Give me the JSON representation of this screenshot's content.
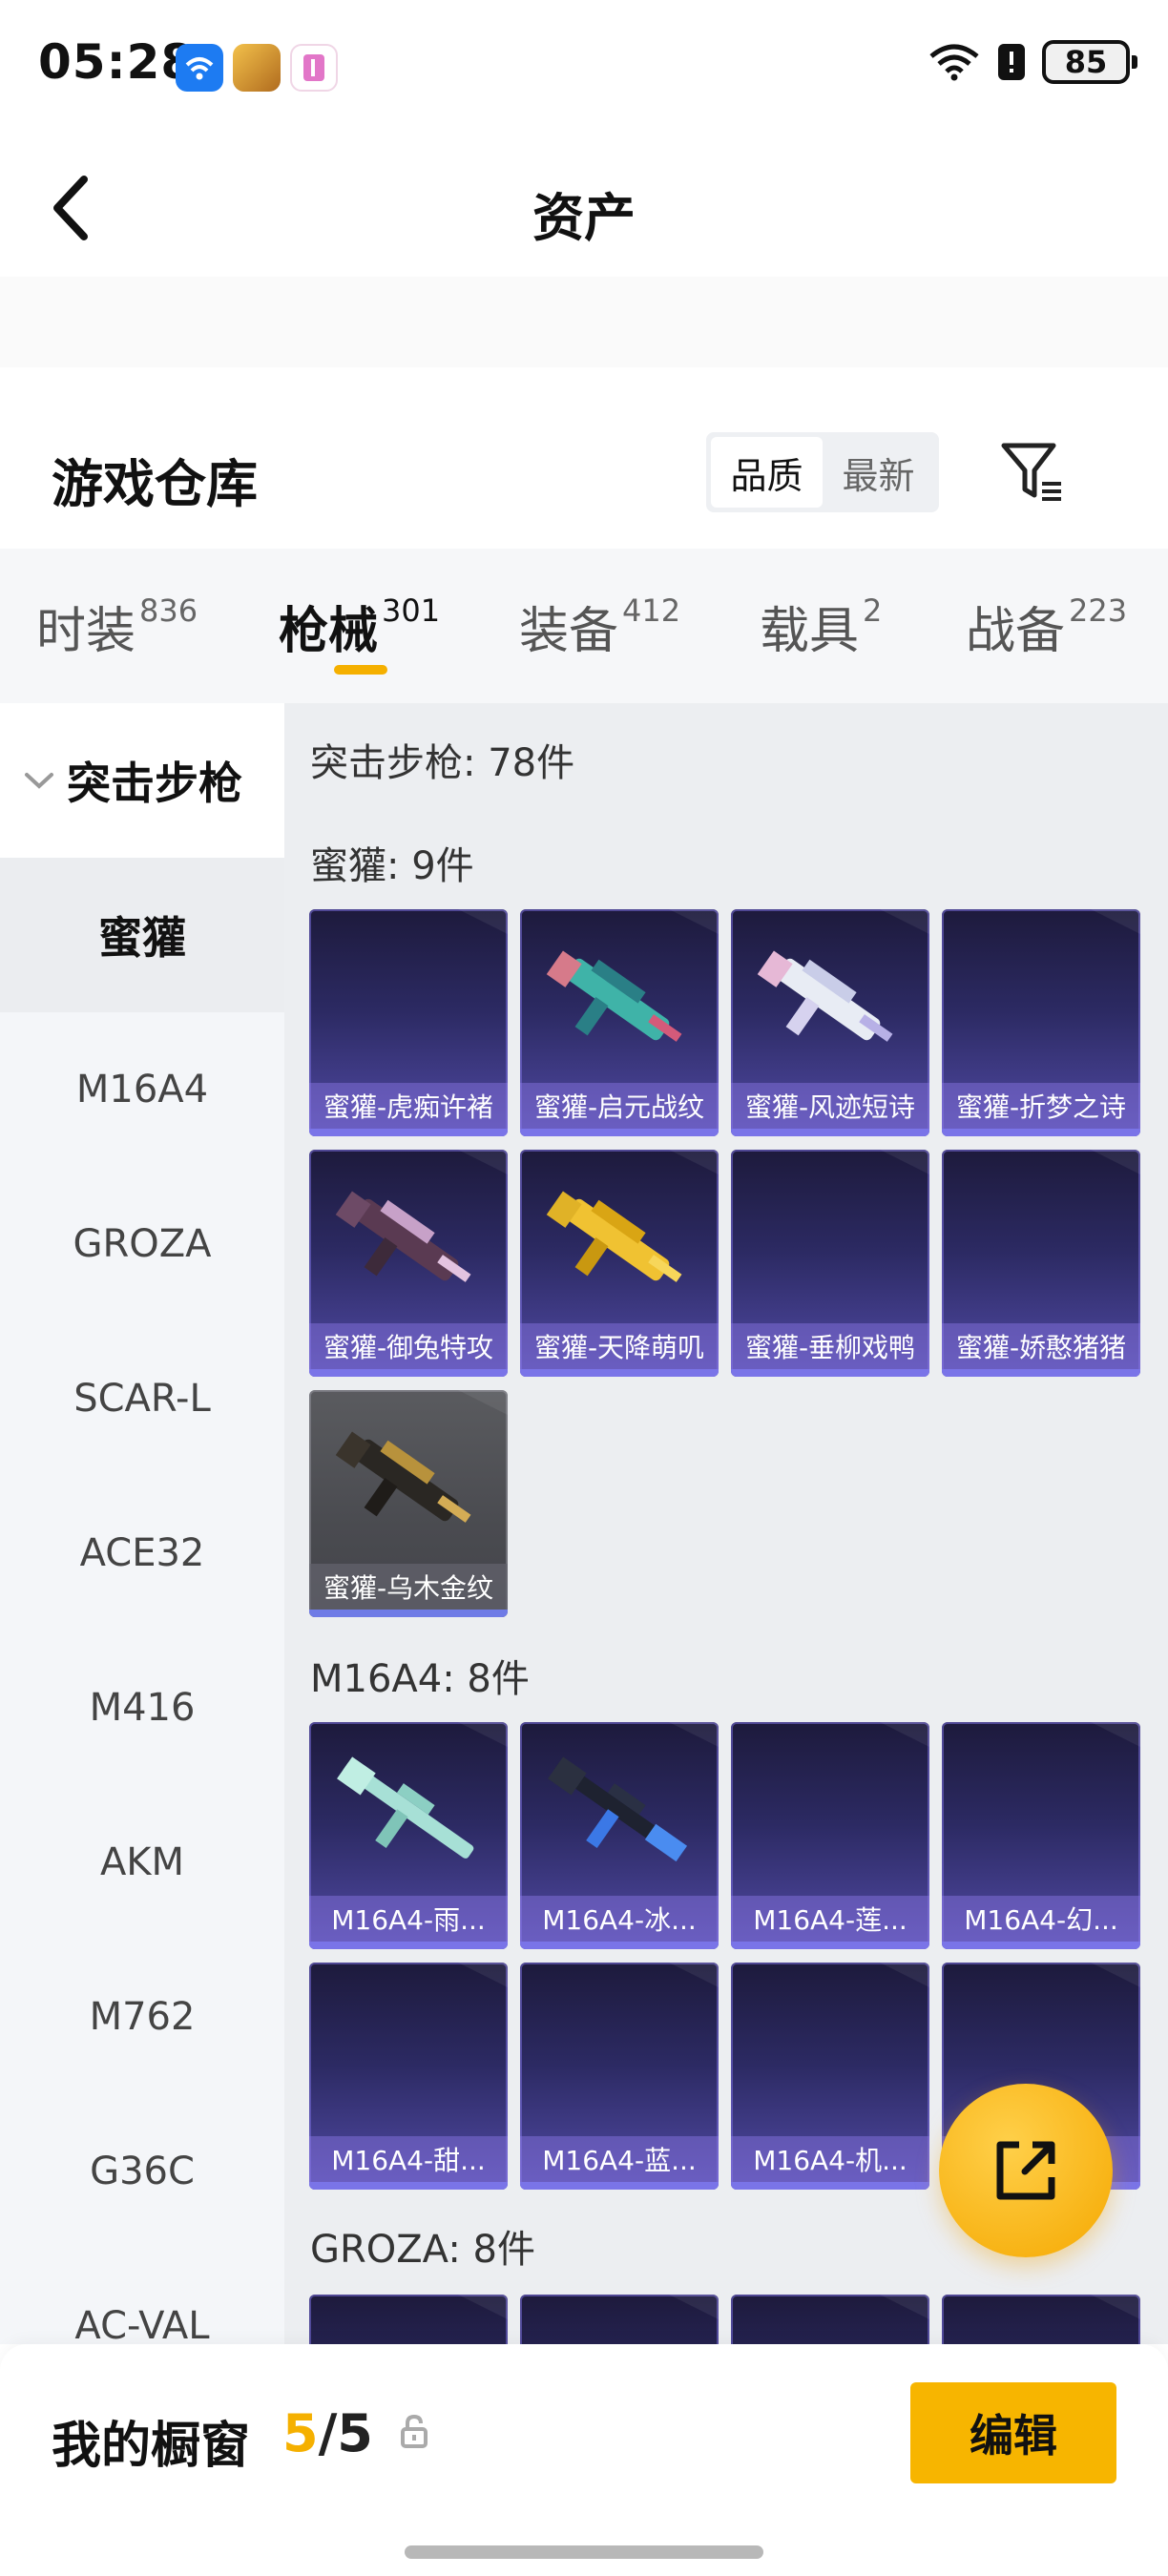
{
  "status_bar": {
    "time": "05:28",
    "battery": "85"
  },
  "header": {
    "title": "资产"
  },
  "warehouse": {
    "title": "游戏仓库",
    "sort_options": [
      "品质",
      "最新"
    ],
    "active_sort": "品质"
  },
  "tabs": [
    {
      "label": "时装",
      "count": "836"
    },
    {
      "label": "枪械",
      "count": "301"
    },
    {
      "label": "装备",
      "count": "412"
    },
    {
      "label": "载具",
      "count": "2"
    },
    {
      "label": "战备",
      "count": "223"
    }
  ],
  "active_tab": "枪械",
  "categories": {
    "group": "突击步枪",
    "items": [
      "蜜獾",
      "M16A4",
      "GROZA",
      "SCAR-L",
      "ACE32",
      "M416",
      "AKM",
      "M762",
      "G36C",
      "AC-VAL"
    ],
    "active": "蜜獾"
  },
  "content": {
    "total_label": "突击步枪: 78件",
    "sections": [
      {
        "label": "蜜獾: 9件",
        "items": [
          {
            "name": "蜜獾-虎痴许褚",
            "icon": ""
          },
          {
            "name": "蜜獾-启元战纹",
            "icon": "teal-smg-icon"
          },
          {
            "name": "蜜獾-风迹短诗",
            "icon": "white-smg-icon"
          },
          {
            "name": "蜜獾-折梦之诗",
            "icon": ""
          },
          {
            "name": "蜜獾-御兔特攻",
            "icon": "purple-smg-icon"
          },
          {
            "name": "蜜獾-天降萌叽",
            "icon": "yellow-smg-icon"
          },
          {
            "name": "蜜獾-垂柳戏鸭",
            "icon": ""
          },
          {
            "name": "蜜獾-娇憨猪猪",
            "icon": ""
          },
          {
            "name": "蜜獾-乌木金纹",
            "icon": "gold-smg-icon"
          }
        ]
      },
      {
        "label": "M16A4: 8件",
        "items": [
          {
            "name": "M16A4-雨...",
            "icon": "mint-rifle-icon"
          },
          {
            "name": "M16A4-冰...",
            "icon": "blue-rifle-icon"
          },
          {
            "name": "M16A4-莲...",
            "icon": ""
          },
          {
            "name": "M16A4-幻...",
            "icon": ""
          },
          {
            "name": "M16A4-甜...",
            "icon": ""
          },
          {
            "name": "M16A4-蓝...",
            "icon": ""
          },
          {
            "name": "M16A4-机...",
            "icon": ""
          },
          {
            "name": "",
            "icon": ""
          }
        ]
      },
      {
        "label": "GROZA: 8件"
      }
    ]
  },
  "bottom": {
    "window_label": "我的橱窗",
    "window_current": "5",
    "window_total": "/5",
    "edit_label": "编辑"
  },
  "colors": {
    "accent": "#f5b000",
    "tile_purple": "#514aa5"
  }
}
